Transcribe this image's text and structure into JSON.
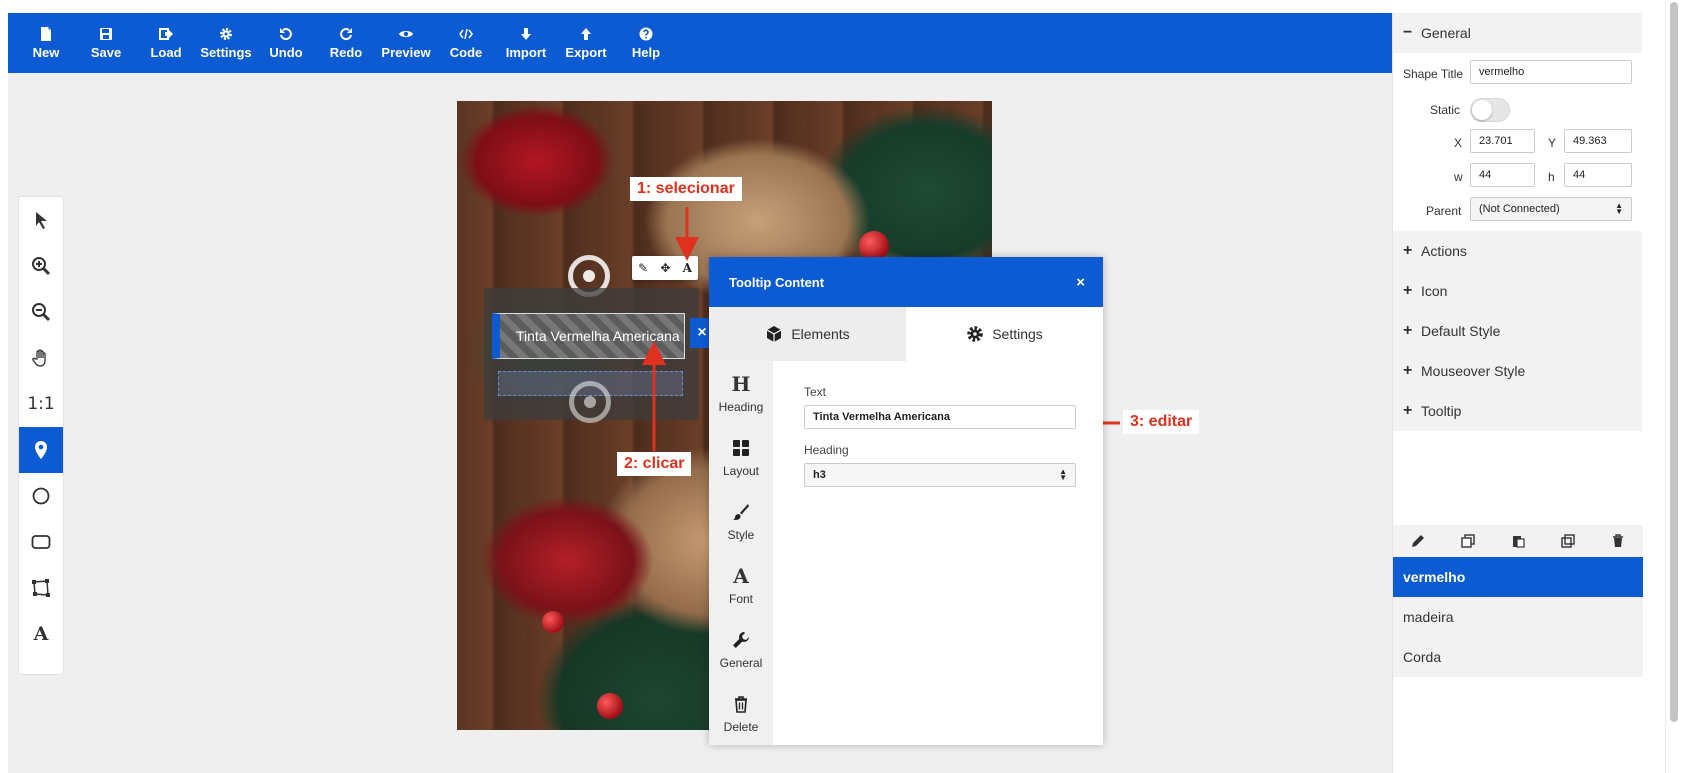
{
  "toolbar": {
    "items": [
      {
        "label": "New",
        "icon": "file-icon"
      },
      {
        "label": "Save",
        "icon": "save-icon"
      },
      {
        "label": "Load",
        "icon": "load-icon"
      },
      {
        "label": "Settings",
        "icon": "gear-icon"
      },
      {
        "label": "Undo",
        "icon": "undo-icon"
      },
      {
        "label": "Redo",
        "icon": "redo-icon"
      },
      {
        "label": "Preview",
        "icon": "eye-icon"
      },
      {
        "label": "Code",
        "icon": "code-icon"
      },
      {
        "label": "Import",
        "icon": "arrow-down-icon"
      },
      {
        "label": "Export",
        "icon": "arrow-up-icon"
      },
      {
        "label": "Help",
        "icon": "question-icon"
      }
    ]
  },
  "tools": {
    "items": [
      "pointer-icon",
      "zoom-in-icon",
      "zoom-out-icon",
      "hand-icon",
      "one-to-one",
      "marker-icon",
      "circle-icon",
      "rect-icon",
      "polygon-icon",
      "text-icon"
    ],
    "one_to_one": "1:1",
    "text_glyph": "A",
    "active": "marker-icon"
  },
  "canvas": {
    "tooltip_text": "Tinta Vermelha Americana",
    "shape_toolbar": [
      "brush",
      "move",
      "A"
    ]
  },
  "annotations": {
    "step1": "1: selecionar",
    "step2": "2: clicar",
    "step3": "3: editar"
  },
  "dialog": {
    "title": "Tooltip Content",
    "close": "×",
    "tabs": [
      {
        "label": "Elements",
        "icon": "cube-icon",
        "active": false
      },
      {
        "label": "Settings",
        "icon": "gear-icon",
        "active": true
      }
    ],
    "side": [
      {
        "label": "Heading",
        "glyph": "H"
      },
      {
        "label": "Layout",
        "glyph": ""
      },
      {
        "label": "Style",
        "glyph": ""
      },
      {
        "label": "Font",
        "glyph": "A"
      },
      {
        "label": "General",
        "glyph": ""
      },
      {
        "label": "Delete",
        "glyph": ""
      }
    ],
    "form": {
      "text_label": "Text",
      "text_value": "Tinta Vermelha Americana",
      "heading_label": "Heading",
      "heading_value": "h3"
    }
  },
  "panel": {
    "general": {
      "title": "General",
      "sign": "−",
      "shape_title_label": "Shape Title",
      "shape_title_value": "vermelho",
      "static_label": "Static",
      "static_on": false,
      "x_label": "X",
      "x_value": "23.701",
      "y_label": "Y",
      "y_value": "49.363",
      "w_label": "w",
      "w_value": "44",
      "h_label": "h",
      "h_value": "44",
      "parent_label": "Parent",
      "parent_value": "(Not Connected)"
    },
    "sections": [
      {
        "title": "Actions",
        "sign": "+"
      },
      {
        "title": "Icon",
        "sign": "+"
      },
      {
        "title": "Default Style",
        "sign": "+"
      },
      {
        "title": "Mouseover Style",
        "sign": "+"
      },
      {
        "title": "Tooltip",
        "sign": "+"
      }
    ],
    "shape_actions": [
      "pencil-icon",
      "copy-style-icon",
      "paste-style-icon",
      "duplicate-icon",
      "trash-icon"
    ],
    "shapes": [
      {
        "name": "vermelho",
        "active": true
      },
      {
        "name": "madeira",
        "active": false
      },
      {
        "name": "Corda",
        "active": false
      }
    ]
  },
  "colors": {
    "accent": "#0d5bd2",
    "annotation": "#e0301e"
  }
}
